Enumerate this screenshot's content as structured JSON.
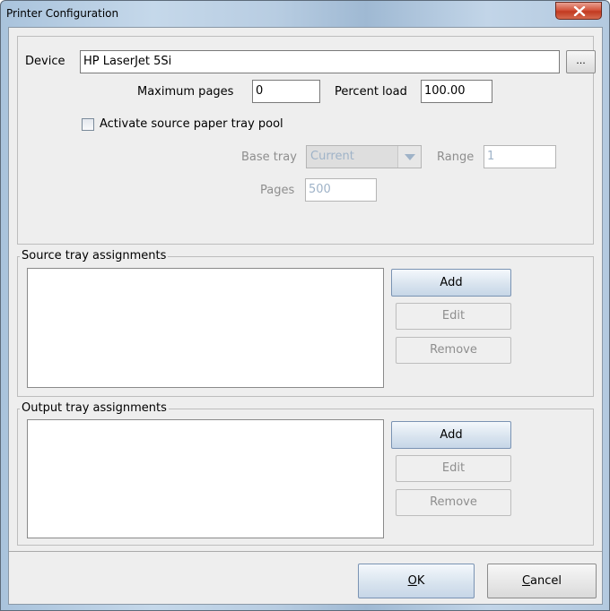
{
  "window": {
    "title": "Printer Configuration",
    "close_icon": "close-icon"
  },
  "device": {
    "label": "Device",
    "value": "HP LaserJet 5Si",
    "browse_label": "..."
  },
  "limits": {
    "max_pages_label": "Maximum pages",
    "max_pages_value": "0",
    "percent_load_label": "Percent load",
    "percent_load_value": "100.00"
  },
  "pool": {
    "checkbox_label": "Activate source paper tray pool",
    "checked": false,
    "base_tray_label": "Base tray",
    "base_tray_value": "Current",
    "range_label": "Range",
    "range_value": "1",
    "pages_label": "Pages",
    "pages_value": "500"
  },
  "source_trays": {
    "legend": "Source tray assignments",
    "add_label": "Add",
    "edit_label": "Edit",
    "remove_label": "Remove"
  },
  "output_trays": {
    "legend": "Output tray assignments",
    "add_label": "Add",
    "edit_label": "Edit",
    "remove_label": "Remove"
  },
  "footer": {
    "ok_prefix": "O",
    "ok_rest": "K",
    "cancel_prefix": "C",
    "cancel_rest": "ancel"
  }
}
